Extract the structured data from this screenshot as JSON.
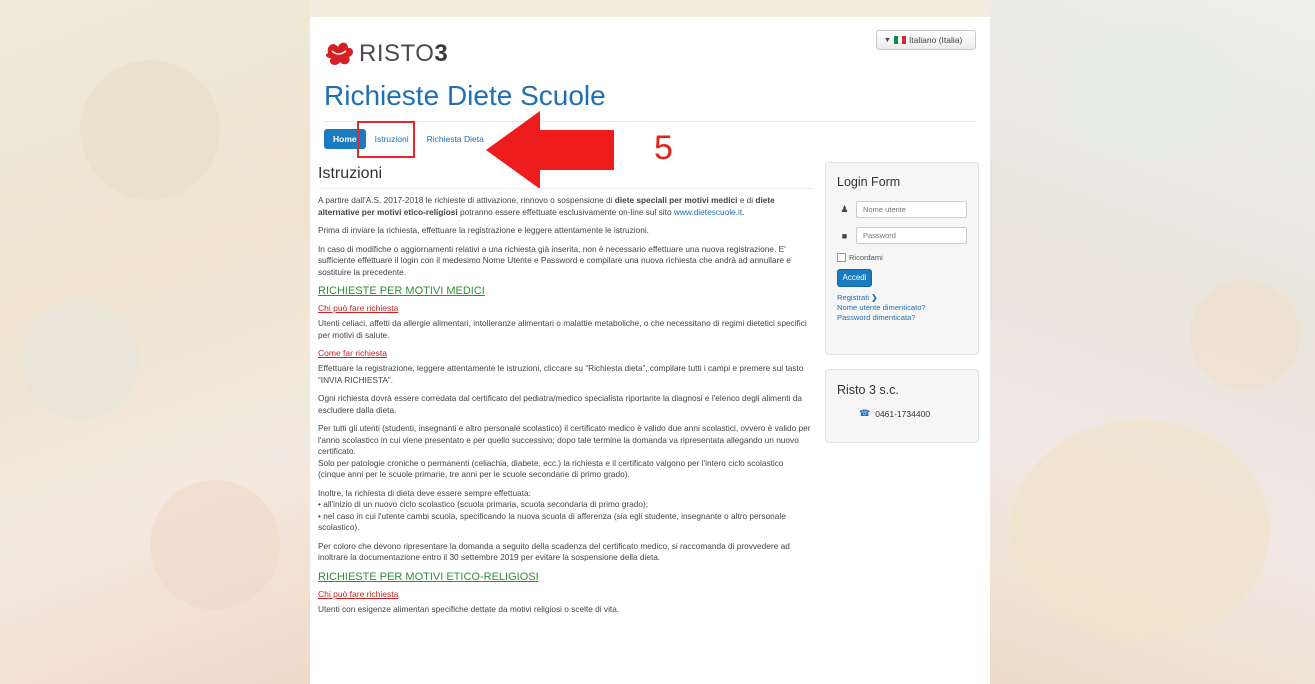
{
  "language": {
    "selected": "Italiano (Italia)",
    "flag_colors": [
      "#009246",
      "#ffffff",
      "#ce2b37"
    ]
  },
  "brand": {
    "logo_text_a": "RISTO",
    "logo_text_b": "3",
    "site_title": "Richieste Diete Scuole",
    "accent": "#1f6fb5"
  },
  "nav": {
    "home": "Home",
    "istruzioni": "Istruzioni",
    "richiesta": "Richiesta Dieta"
  },
  "annotation": {
    "step": "5",
    "color": "#e2231a"
  },
  "content": {
    "title": "Istruzioni",
    "intro_a": "A partire dall'A.S. 2017-2018 le richieste di attivazione, rinnovo o sospensione di ",
    "intro_b": "diete speciali per motivi medici",
    "intro_c": " e di ",
    "intro_d": "diete alternative per motivi etico-religiosi",
    "intro_e": " potranno essere effettuate esclusivamente on-line sul sito ",
    "intro_link": "www.dietescuole.it",
    "intro_f": ".",
    "p2": "Prima di inviare la richiesta, effettuare la registrazione e leggere attentamente le istruzioni.",
    "p3": "In caso di modifiche o aggiornamenti relativi a una richiesta già inserita, non è necessario effettuare una nuova registrazione. E' sufficiente effettuare il login con il medesimo Nome Utente e Password e compilare una nuova richiesta che andrà ad annullare e sostituire la precedente.",
    "sec1": "RICHIESTE PER MOTIVI MEDICI",
    "sub1": "Chi può fare richiesta",
    "p4": "Utenti celiaci, affetti da allergie alimentari, intolleranze alimentari o malattie metaboliche, o che necessitano di regimi dietetici specifici per motivi di salute.",
    "sub2": "Come far richiesta",
    "p5": "Effettuare la registrazione, leggere attentamente le istruzioni, cliccare su “Richiesta dieta”, compilare tutti i campi e premere sul tasto “INVIA RICHIESTA”.",
    "p6": "Ogni richiesta dovrà essere corredata dal certificato del pediatra/medico specialista riportante la diagnosi e l'elenco degli alimenti da escludere dalla dieta.",
    "p7": "Per tutti gli utenti (studenti, insegnanti e altro personale scolastico) il certificato medico è valido due anni scolastici, ovvero è valido per l'anno scolastico in cui viene presentato e per quello successivo; dopo tale termine la domanda va ripresentata allegando un nuovo certificato.",
    "p7b": "Solo per patologie croniche o permanenti (celiachia, diabete, ecc.) la richiesta e il certificato valgono per l'intero ciclo scolastico (cinque anni per le scuole primarie, tre anni per le scuole secondarie di primo grado).",
    "p8": "Inoltre, la richiesta di dieta deve essere sempre effettuata:",
    "b1": "•  all'inizio di un nuovo ciclo scolastico (scuola primaria, scuola secondaria di primo grado);",
    "b2": "•  nel caso in cui l'utente cambi scuola, specificando la nuova scuola di afferenza (sia egli studente, insegnante o altro personale scolastico).",
    "p9": "Per coloro che devono ripresentare la domanda a seguito della scadenza del certificato medico, si raccomanda di provvedere ad inoltrare la documentazione entro il 30 settembre 2019 per evitare la sospensione della dieta.",
    "sec2": "RICHIESTE PER MOTIVI ETICO-RELIGIOSI",
    "sub3": "Chi può fare richiesta",
    "p10": "Utenti con esigenze alimentari specifiche dettate da motivi religiosi o scelte di vita."
  },
  "login": {
    "title": "Login Form",
    "username_placeholder": "Nome utente",
    "password_placeholder": "Password",
    "remember": "Ricordami",
    "submit": "Accedi",
    "register": "Registrati",
    "forgot_user": "Nome utente dimenticato?",
    "forgot_pass": "Password dimenticata?"
  },
  "company": {
    "title": "Risto 3 s.c.",
    "phone": "0461-1734400"
  }
}
